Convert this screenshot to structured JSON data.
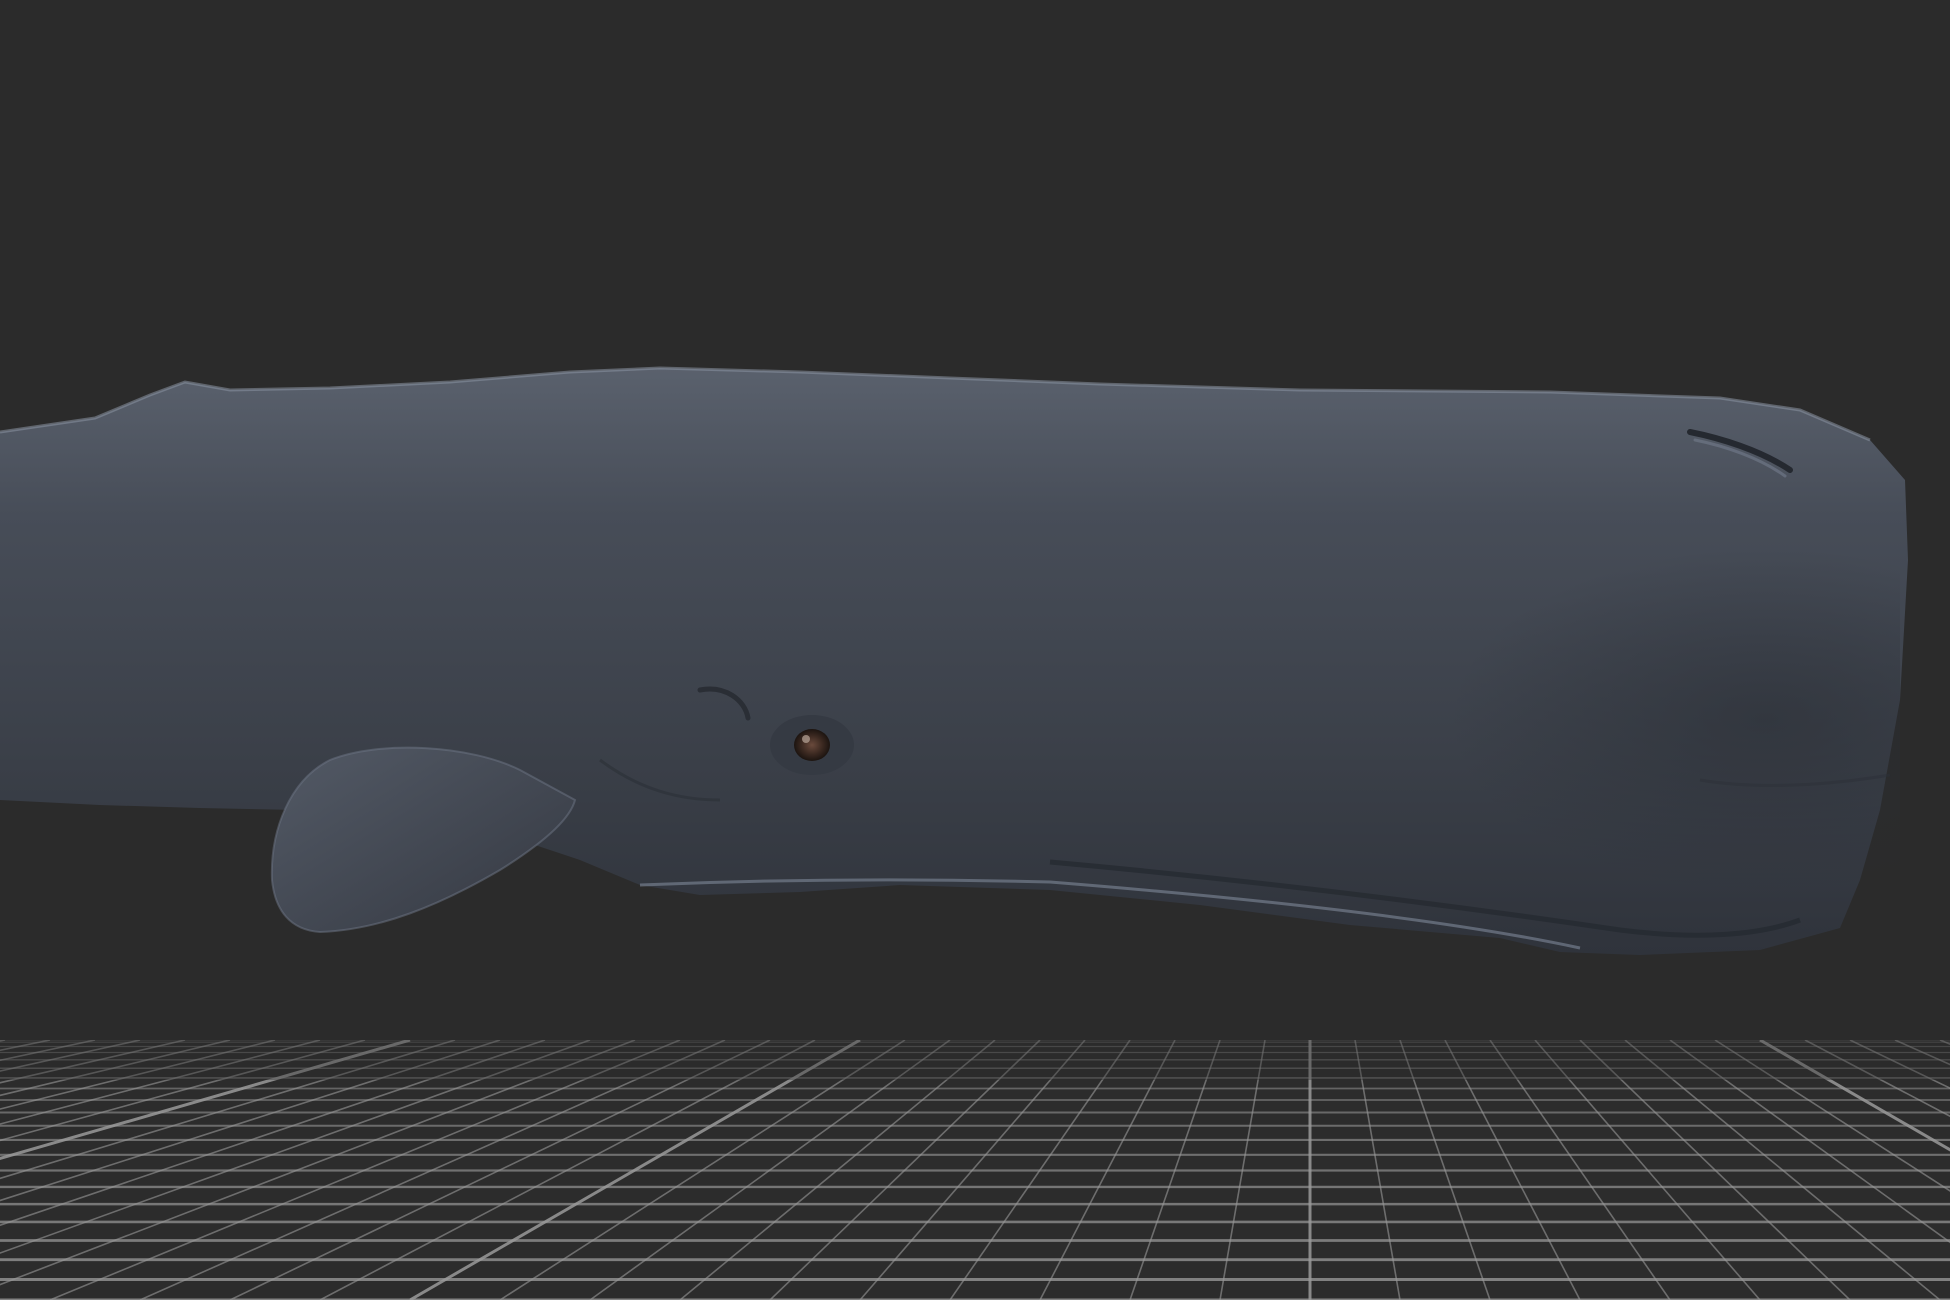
{
  "viewport": {
    "background_color": "#2b2b2b",
    "grid_color": "#9a9a9a",
    "grid_visible": true,
    "model": {
      "subject": "sperm-whale",
      "body_color": "#3b4049",
      "highlight_color": "#5b6270",
      "eye_color": "#3a2820"
    }
  }
}
